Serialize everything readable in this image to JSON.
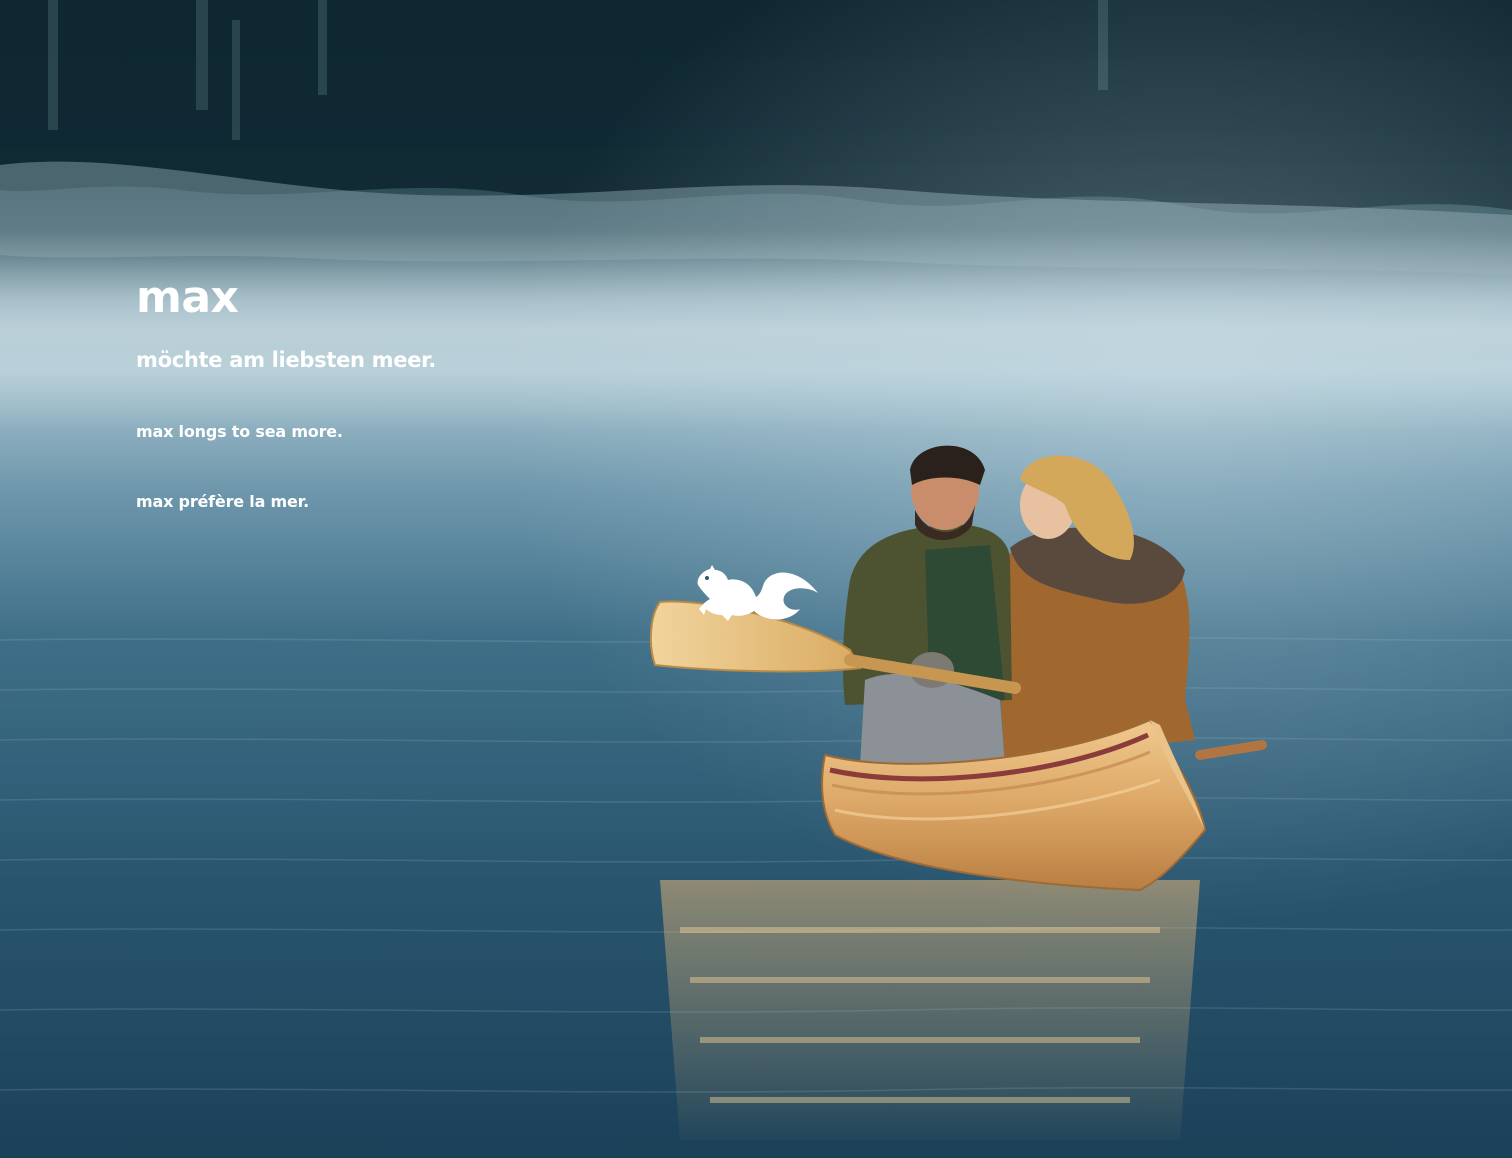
{
  "brand": {
    "name": "max",
    "logo_icon": "squirrel-icon"
  },
  "taglines": {
    "de": "möchte am liebsten meer.",
    "en": "max longs to sea more.",
    "fr": "max préfère la mer."
  },
  "colors": {
    "text": "#ffffff",
    "water": "#2f5a70",
    "mist": "#8fb3c4",
    "forest": "#12303b",
    "canoe_wood": "#d9a866"
  }
}
